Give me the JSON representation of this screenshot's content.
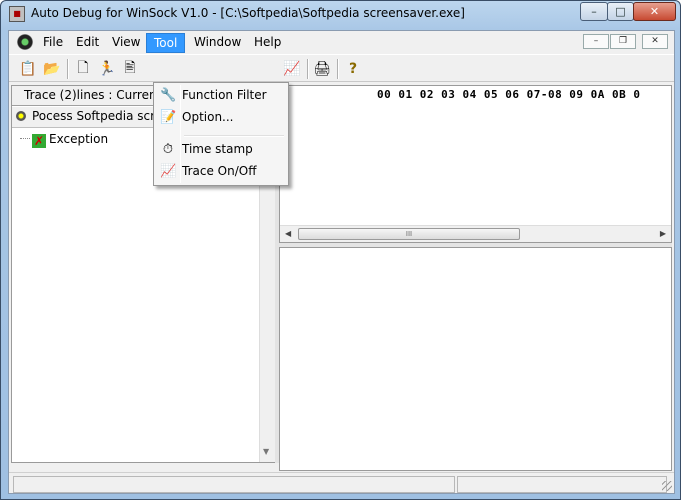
{
  "window": {
    "title": "Auto Debug for WinSock V1.0 - [C:\\Softpedia\\Softpedia screensaver.exe]",
    "app_icon": "app-bug-icon",
    "controls": {
      "minimize": "–",
      "maximize": "□",
      "close": "✕"
    }
  },
  "menubar": {
    "items": [
      "File",
      "Edit",
      "View",
      "Tool",
      "Window",
      "Help"
    ],
    "active": "Tool",
    "mdi_controls": {
      "minimize": "–",
      "restore": "❐",
      "close": "✕"
    }
  },
  "toolbar": {
    "buttons": [
      {
        "name": "open-process-icon",
        "glyph": "📋"
      },
      {
        "name": "open-folder-icon",
        "glyph": "📂"
      },
      {
        "name": "new-file-icon",
        "glyph": "🗋"
      },
      {
        "name": "run-icon",
        "glyph": "🏃"
      },
      {
        "name": "text-file-icon",
        "glyph": "🖹"
      },
      {
        "name": "chart-icon",
        "glyph": "📈"
      },
      {
        "name": "print-icon",
        "glyph": "🖨"
      },
      {
        "name": "help-icon",
        "glyph": "?"
      }
    ]
  },
  "left_pane": {
    "trace_label": "Trace (2)lines : Current",
    "process_label": "Pocess Softpedia screensaver.exe",
    "tree": [
      {
        "label": "Exception",
        "icon": "exception-icon"
      }
    ]
  },
  "hex_view": {
    "header": "00 01 02 03 04 05 06 07-08 09 0A 0B 0",
    "scroll_thumb": "III"
  },
  "tool_menu": {
    "items": [
      {
        "label": "Function Filter",
        "icon": "filter-icon",
        "glyph": "🔧"
      },
      {
        "label": "Option...",
        "icon": "option-icon",
        "glyph": "📝"
      },
      {
        "label": "Time stamp",
        "icon": "stopwatch-icon",
        "glyph": "⏱"
      },
      {
        "label": "Trace On/Off",
        "icon": "trace-icon",
        "glyph": "📈"
      }
    ]
  },
  "colors": {
    "menu_highlight": "#3399ff",
    "title_gradient": "#bcd6ee"
  }
}
